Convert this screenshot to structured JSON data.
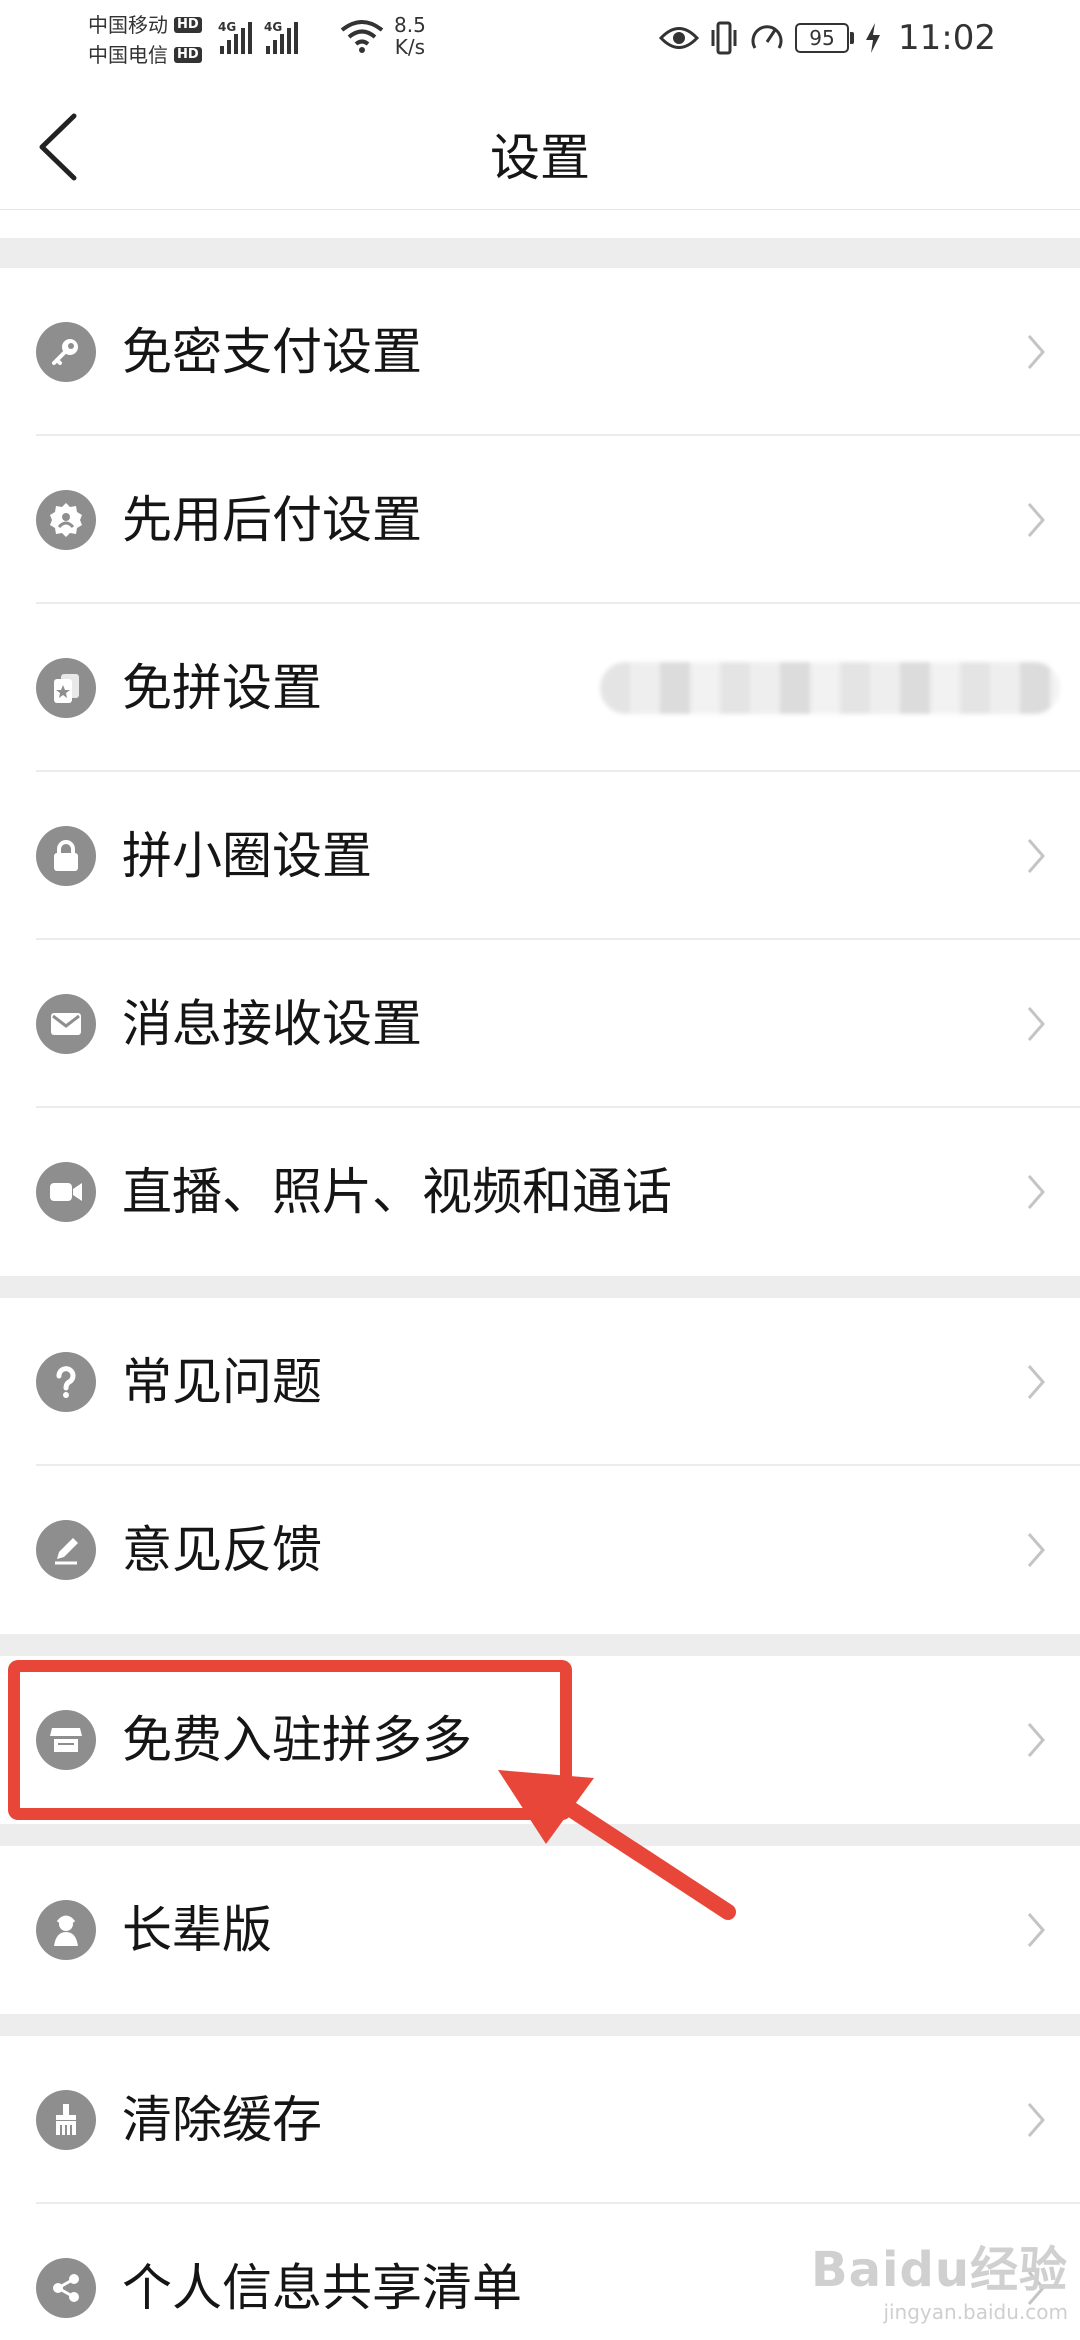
{
  "status_bar": {
    "carrier1": "中国移动",
    "carrier2": "中国电信",
    "hd": "HD",
    "net1": "4G",
    "net2": "4G",
    "speed_value": "8.5",
    "speed_unit": "K/s",
    "battery": "95",
    "time": "11:02"
  },
  "header": {
    "title": "设置"
  },
  "groups": [
    {
      "items": [
        {
          "label": "免密支付设置",
          "icon": "key-icon"
        },
        {
          "label": "先用后付设置",
          "icon": "badge-icon"
        },
        {
          "label": "免拼设置",
          "icon": "cards-icon"
        },
        {
          "label": "拼小圈设置",
          "icon": "lock-icon"
        },
        {
          "label": "消息接收设置",
          "icon": "mail-icon"
        },
        {
          "label": "直播、照片、视频和通话",
          "icon": "video-icon"
        }
      ]
    },
    {
      "items": [
        {
          "label": "常见问题",
          "icon": "question-icon"
        },
        {
          "label": "意见反馈",
          "icon": "pencil-icon"
        }
      ]
    },
    {
      "items": [
        {
          "label": "免费入驻拼多多",
          "icon": "store-icon"
        }
      ]
    },
    {
      "items": [
        {
          "label": "长辈版",
          "icon": "elder-icon"
        }
      ]
    },
    {
      "items": [
        {
          "label": "清除缓存",
          "icon": "broom-icon"
        },
        {
          "label": "个人信息共享清单",
          "icon": "share-icon"
        }
      ]
    }
  ],
  "watermark": {
    "main": "Baidu经验",
    "sub": "jingyan.baidu.com"
  },
  "colors": {
    "highlight": "#e9463a",
    "icon_bg": "#8e8e8e",
    "section_gap": "#ededed"
  }
}
